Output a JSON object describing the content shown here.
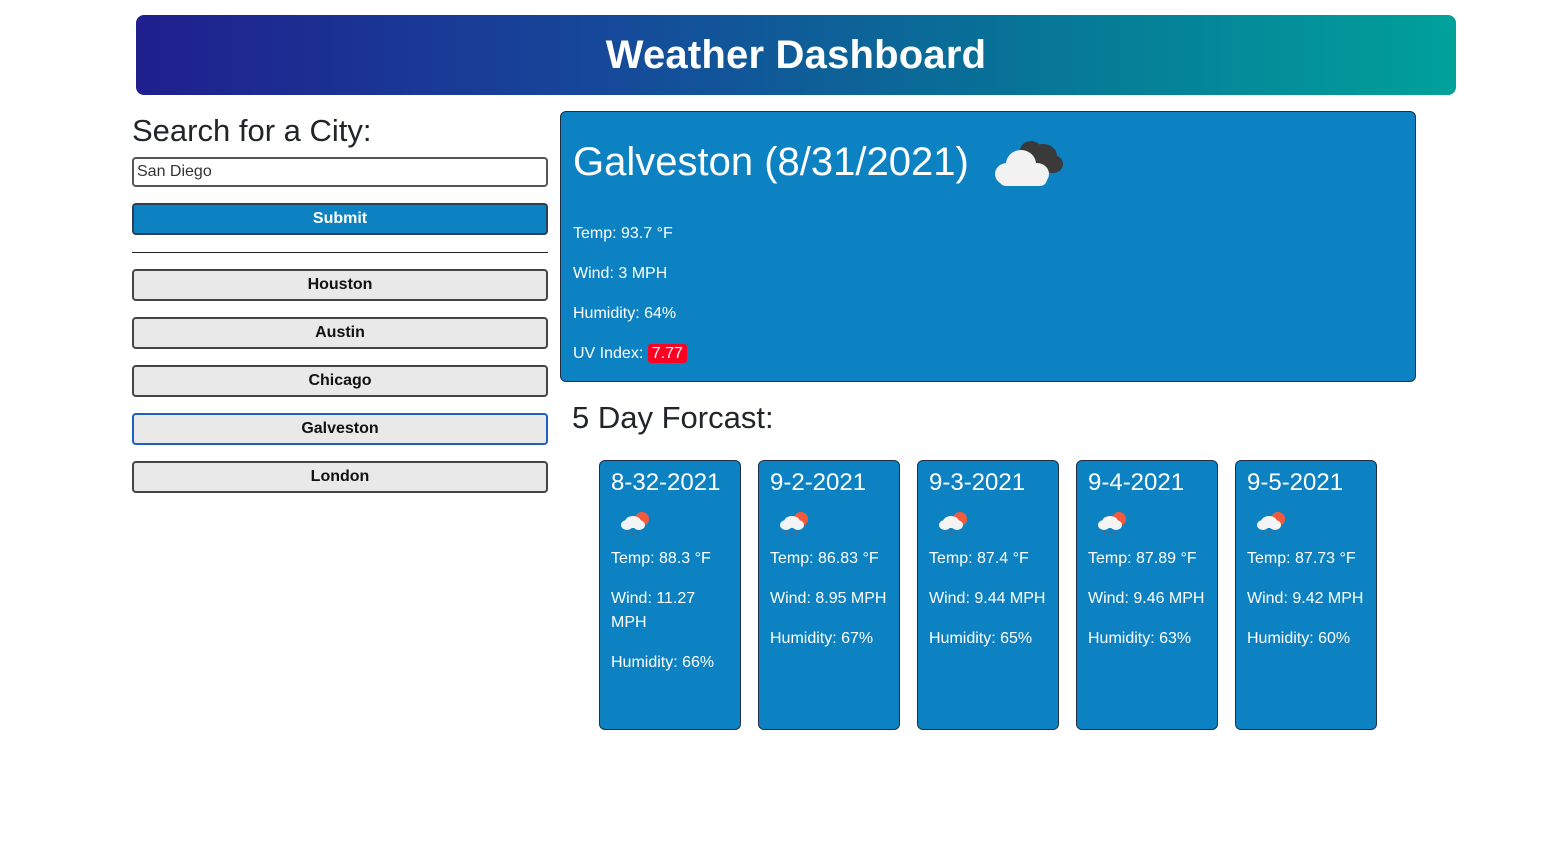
{
  "header": {
    "title": "Weather Dashboard"
  },
  "search": {
    "title": "Search for a City:",
    "value": "San Diego",
    "submit_label": "Submit"
  },
  "history": [
    {
      "label": "Houston"
    },
    {
      "label": "Austin"
    },
    {
      "label": "Chicago"
    },
    {
      "label": "Galveston"
    },
    {
      "label": "London"
    }
  ],
  "current": {
    "title": "Galveston (8/31/2021)",
    "icon": "cloudy-icon",
    "temp": "Temp: 93.7 °F",
    "wind": "Wind: 3 MPH",
    "humidity": "Humidity: 64%",
    "uv_label": "UV Index:",
    "uv_value": "7.77",
    "uv_color": "#ff0022"
  },
  "forecast": {
    "title": "5 Day Forcast:",
    "days": [
      {
        "date": "8-32-2021",
        "icon": "rain-sun-icon",
        "temp": "Temp: 88.3 °F",
        "wind": "Wind: 11.27 MPH",
        "humidity": "Humidity: 66%"
      },
      {
        "date": "9-2-2021",
        "icon": "rain-sun-icon",
        "temp": "Temp: 86.83 °F",
        "wind": "Wind: 8.95 MPH",
        "humidity": "Humidity: 67%"
      },
      {
        "date": "9-3-2021",
        "icon": "rain-sun-icon",
        "temp": "Temp: 87.4 °F",
        "wind": "Wind: 9.44 MPH",
        "humidity": "Humidity: 65%"
      },
      {
        "date": "9-4-2021",
        "icon": "rain-sun-icon",
        "temp": "Temp: 87.89 °F",
        "wind": "Wind: 9.46 MPH",
        "humidity": "Humidity: 63%"
      },
      {
        "date": "9-5-2021",
        "icon": "rain-sun-icon",
        "temp": "Temp: 87.73 °F",
        "wind": "Wind: 9.42 MPH",
        "humidity": "Humidity: 60%"
      }
    ]
  },
  "colors": {
    "card_blue": "#0d82c2",
    "header_gradient_start": "#1f1f8e",
    "header_gradient_end": "#00a19b"
  }
}
